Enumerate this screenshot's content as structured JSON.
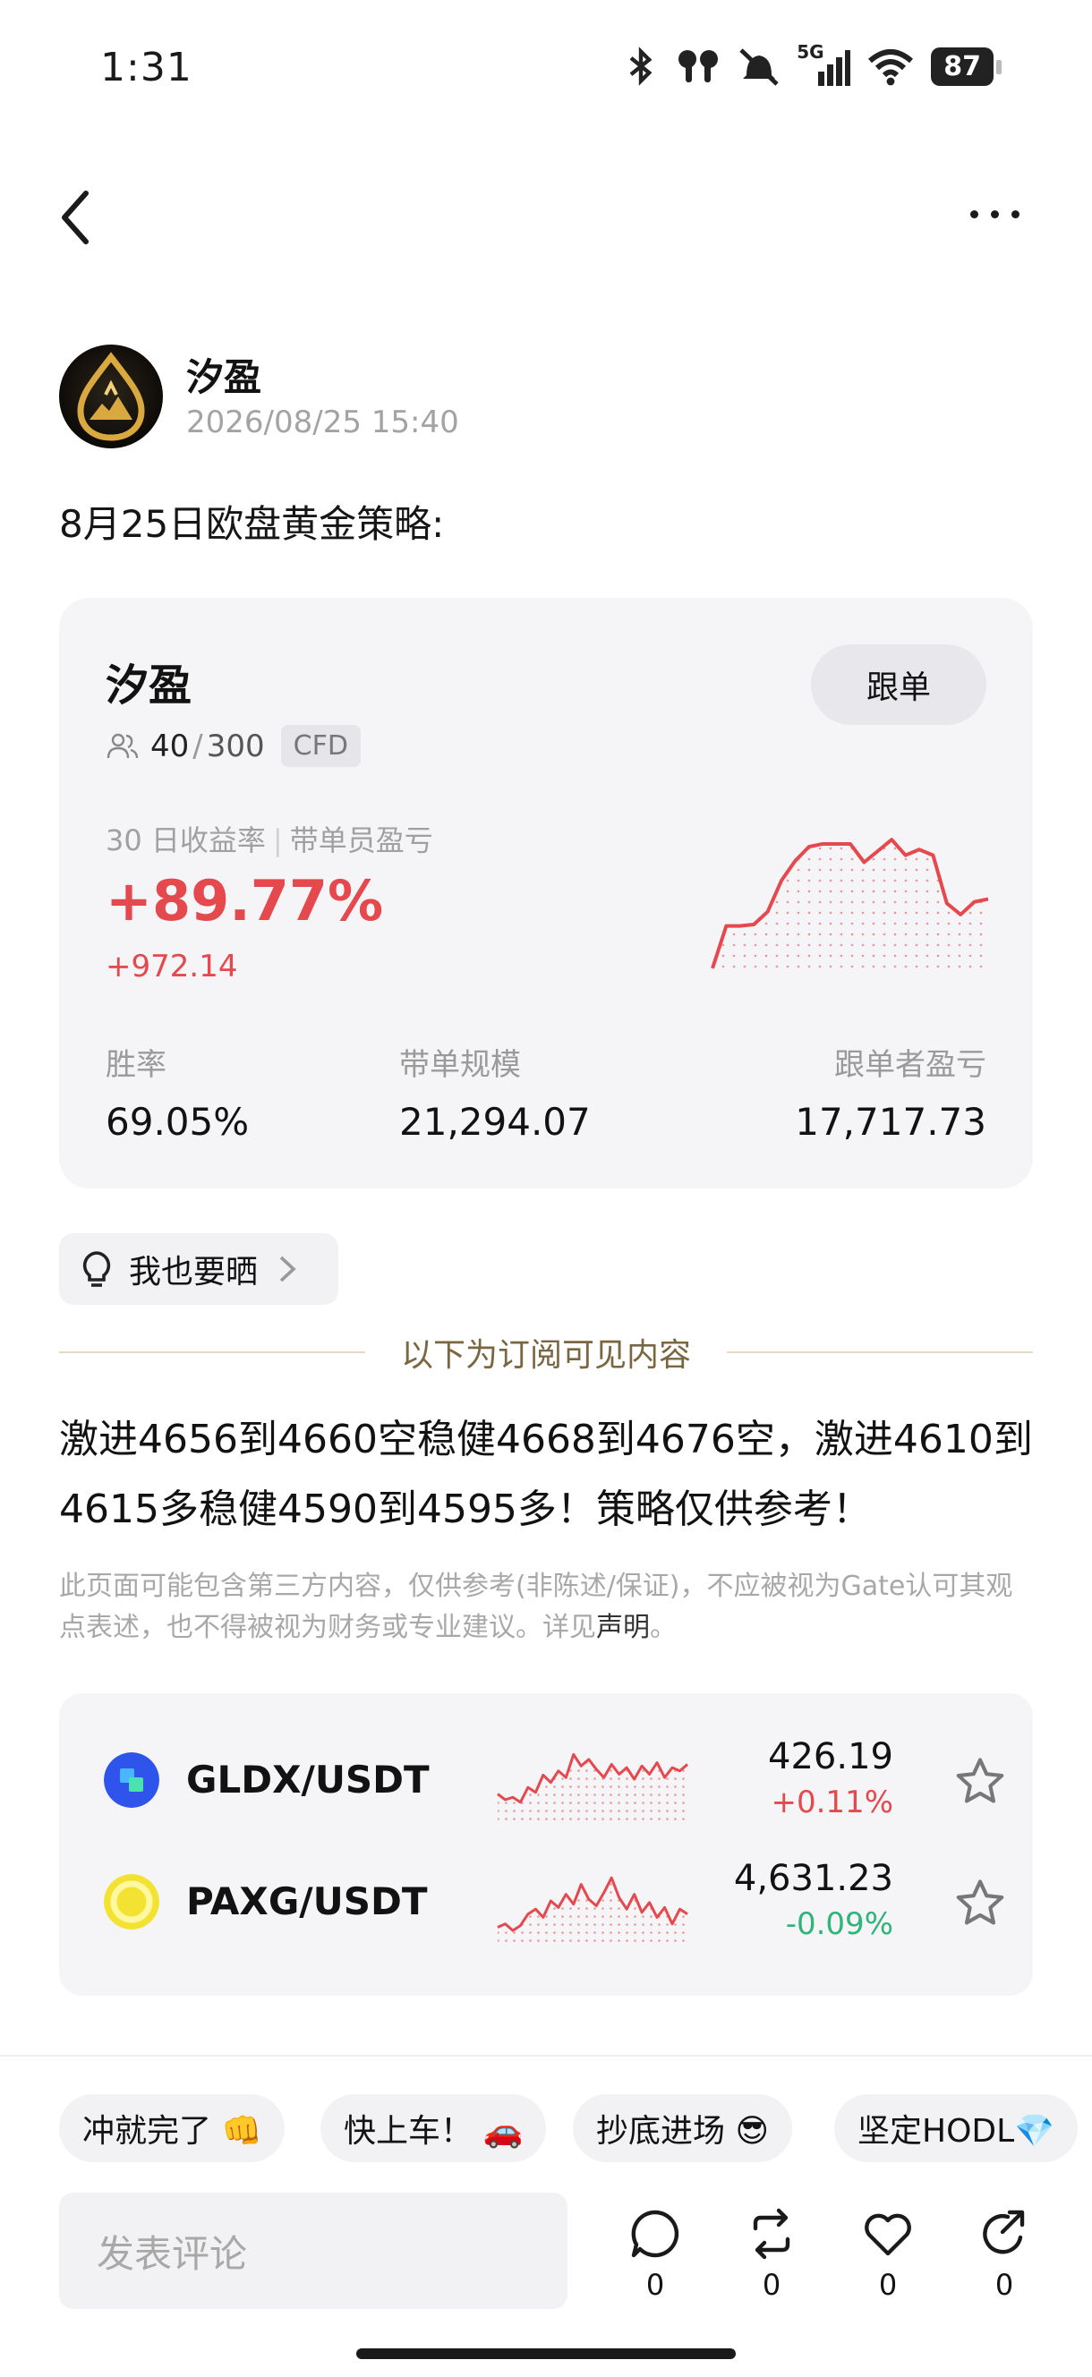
{
  "status_bar": {
    "time": "1:31",
    "network": "5G",
    "battery": "87"
  },
  "author": {
    "name": "汐盈",
    "timestamp": "2026/08/25 15:40"
  },
  "post": {
    "title": "8月25日欧盘黄金策略:",
    "body": "激进4656到4660空稳健4668到4676空，激进4610到4615多稳健4590到4595多！策略仅供参考！",
    "disclaimer": "此页面可能包含第三方内容，仅供参考(非陈述/保证)，不应被视为Gate认可其观点表述，也不得被视为财务或专业建议。详见",
    "disclaimer_link": "声明",
    "disclaimer_end": "。"
  },
  "strategy_card": {
    "name": "汐盈",
    "follow_label": "跟单",
    "members_current": "40",
    "members_sep": "/",
    "members_max": "300",
    "tag": "CFD",
    "metric_label": "30 日收益率",
    "metric_sep": "|",
    "metric_label2": "带单员盈亏",
    "return_pct": "+89.77%",
    "return_abs": "+972.14",
    "accent_color": "#e5484d",
    "stats": [
      {
        "label": "胜率",
        "value": "69.05%"
      },
      {
        "label": "带单规模",
        "value": "21,294.07"
      },
      {
        "label": "跟单者盈亏",
        "value": "17,717.73"
      }
    ],
    "sparkline": [
      0.0,
      0.3,
      0.3,
      0.31,
      0.4,
      0.62,
      0.76,
      0.86,
      0.88,
      0.88,
      0.88,
      0.75,
      0.83,
      0.91,
      0.8,
      0.84,
      0.8,
      0.46,
      0.38,
      0.47,
      0.49
    ]
  },
  "share": {
    "label": "我也要晒"
  },
  "divider_text": "以下为订阅可见内容",
  "tickers": [
    {
      "pair": "GLDX/USDT",
      "price": "426.19",
      "change": "+0.11%",
      "direction": "up",
      "coin_color": "#2f54eb",
      "spark": [
        0.32,
        0.25,
        0.28,
        0.22,
        0.4,
        0.34,
        0.55,
        0.46,
        0.6,
        0.52,
        0.8,
        0.66,
        0.74,
        0.62,
        0.52,
        0.68,
        0.56,
        0.64,
        0.5,
        0.66,
        0.56,
        0.7,
        0.52,
        0.64,
        0.6,
        0.68
      ]
    },
    {
      "pair": "PAXG/USDT",
      "price": "4,631.23",
      "change": "-0.09%",
      "direction": "down",
      "coin_color": "#e8d200",
      "spark": [
        0.18,
        0.22,
        0.14,
        0.2,
        0.34,
        0.4,
        0.3,
        0.5,
        0.42,
        0.58,
        0.46,
        0.7,
        0.52,
        0.44,
        0.6,
        0.78,
        0.54,
        0.4,
        0.58,
        0.36,
        0.48,
        0.3,
        0.42,
        0.22,
        0.4,
        0.34
      ]
    }
  ],
  "quick_replies": [
    "冲就完了 👊",
    "快上车！ 🚗",
    "抄底进场 😎",
    "坚定HODL💎"
  ],
  "comment_placeholder": "发表评论",
  "actions": [
    {
      "icon": "comment-icon",
      "count": "0"
    },
    {
      "icon": "repost-icon",
      "count": "0"
    },
    {
      "icon": "like-icon",
      "count": "0"
    },
    {
      "icon": "share-icon",
      "count": "0"
    }
  ]
}
